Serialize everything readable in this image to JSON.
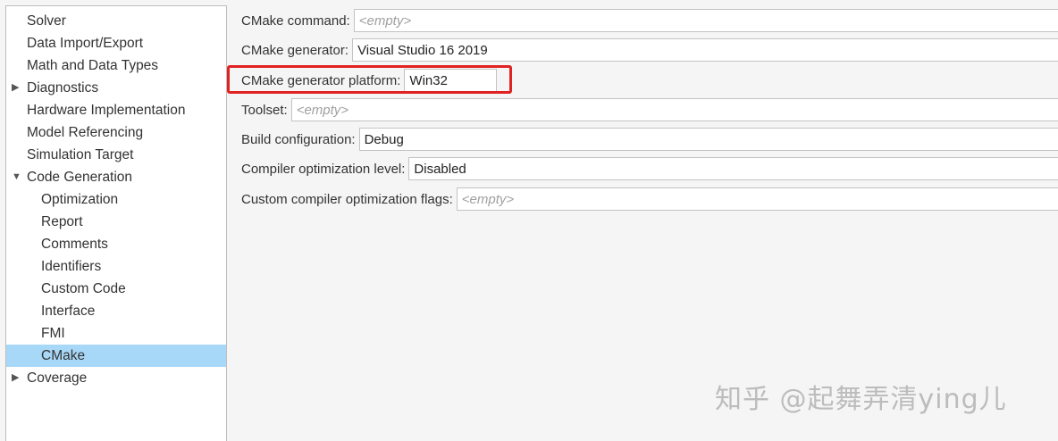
{
  "sidebar": {
    "items": [
      {
        "label": "Solver",
        "level": 0
      },
      {
        "label": "Data Import/Export",
        "level": 0
      },
      {
        "label": "Math and Data Types",
        "level": 0
      },
      {
        "label": "Diagnostics",
        "level": 0,
        "caret": "▶"
      },
      {
        "label": "Hardware Implementation",
        "level": 0
      },
      {
        "label": "Model Referencing",
        "level": 0
      },
      {
        "label": "Simulation Target",
        "level": 0
      },
      {
        "label": "Code Generation",
        "level": 0,
        "caret": "▼"
      },
      {
        "label": "Optimization",
        "level": 1
      },
      {
        "label": "Report",
        "level": 1
      },
      {
        "label": "Comments",
        "level": 1
      },
      {
        "label": "Identifiers",
        "level": 1
      },
      {
        "label": "Custom Code",
        "level": 1
      },
      {
        "label": "Interface",
        "level": 1
      },
      {
        "label": "FMI",
        "level": 1
      },
      {
        "label": "CMake",
        "level": 1,
        "selected": true
      },
      {
        "label": "Coverage",
        "level": 0,
        "caret": "▶"
      }
    ]
  },
  "fields": {
    "cmake_command": {
      "label": "CMake command:",
      "value": "",
      "placeholder": "<empty>"
    },
    "cmake_generator": {
      "label": "CMake generator:",
      "value": "Visual Studio 16 2019",
      "placeholder": ""
    },
    "cmake_generator_platform": {
      "label": "CMake generator platform:",
      "value": "Win32",
      "placeholder": ""
    },
    "toolset": {
      "label": "Toolset:",
      "value": "",
      "placeholder": "<empty>"
    },
    "build_configuration": {
      "label": "Build configuration:",
      "value": "Debug",
      "placeholder": ""
    },
    "compiler_optimization_level": {
      "label": "Compiler optimization level:",
      "value": "Disabled",
      "placeholder": ""
    },
    "custom_compiler_optimization_flags": {
      "label": "Custom compiler optimization flags:",
      "value": "",
      "placeholder": "<empty>"
    }
  },
  "watermark": "知乎 @起舞弄清ying儿",
  "colors": {
    "selection": "#a8d8f8",
    "highlight_border": "#e02222",
    "background": "#f5f5f5"
  }
}
